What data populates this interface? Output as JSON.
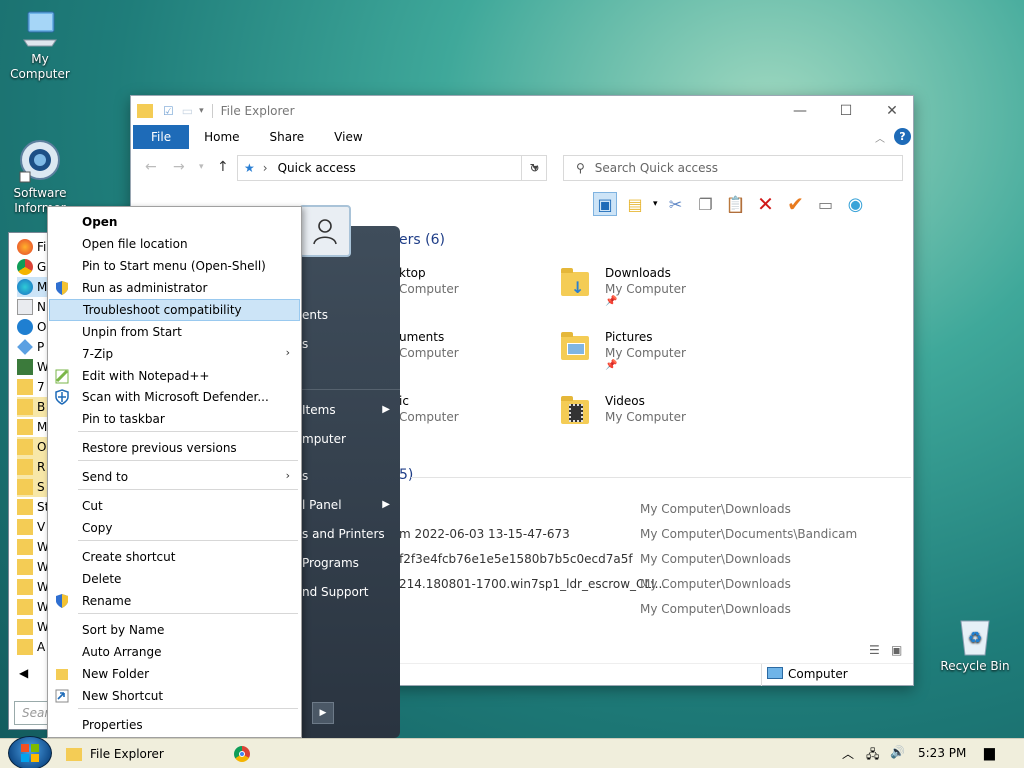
{
  "desktop": {
    "icons": [
      {
        "label": "My Computer",
        "icon": "computer-icon"
      },
      {
        "label": "Software\nInformer",
        "icon": "software-informer-icon"
      },
      {
        "label": "Recycle Bin",
        "icon": "recycle-bin-icon"
      }
    ]
  },
  "explorer": {
    "title": "File Explorer",
    "ribbon_tabs": [
      "File",
      "Home",
      "Share",
      "View"
    ],
    "address": "Quick access",
    "search_placeholder": "Search Quick access",
    "frequent_header": "ers (6)",
    "recent_header": "5)",
    "quick_items": [
      {
        "name": "ktop",
        "sub": "Computer"
      },
      {
        "name": "uments",
        "sub": "Computer"
      },
      {
        "name": "ic",
        "sub": "Computer"
      },
      {
        "name": "Downloads",
        "sub": "My Computer"
      },
      {
        "name": "Pictures",
        "sub": "My Computer"
      },
      {
        "name": "Videos",
        "sub": "My Computer"
      }
    ],
    "recent_files": [
      {
        "name": "",
        "path": "My Computer\\Downloads"
      },
      {
        "name": "m 2022-06-03 13-15-47-673",
        "path": "My Computer\\Documents\\Bandicam"
      },
      {
        "name": "f2f3e4fcb76e1e5e1580b7b5c0ecd7a5f",
        "path": "My Computer\\Downloads"
      },
      {
        "name": "214.180801-1700.win7sp1_ldr_escrow_CLI...",
        "path": "My Computer\\Downloads"
      },
      {
        "name": "",
        "path": "My Computer\\Downloads"
      }
    ],
    "status_location": "Computer"
  },
  "start_menu": {
    "left_items": [
      "Fi",
      "G",
      "M",
      "N",
      "O",
      "P",
      "W",
      "7",
      "B",
      "M",
      "O",
      "R",
      "S",
      "St",
      "V",
      "W",
      "W",
      "W",
      "W",
      "W",
      "A"
    ],
    "search_placeholder": "Sear",
    "right_items": [
      {
        "label": "ents",
        "arrow": false
      },
      {
        "label": "s",
        "arrow": false
      },
      {
        "label": "Items",
        "arrow": true
      },
      {
        "label": "mputer",
        "arrow": false
      },
      {
        "label": "s",
        "arrow": false
      },
      {
        "label": "l Panel",
        "arrow": true
      },
      {
        "label": "s and Printers",
        "arrow": false
      },
      {
        "label": "Programs",
        "arrow": false
      },
      {
        "label": "nd Support",
        "arrow": false
      }
    ]
  },
  "context_menu": {
    "items": [
      {
        "label": "Open",
        "bold": true
      },
      {
        "label": "Open file location"
      },
      {
        "label": "Pin to Start menu (Open-Shell)"
      },
      {
        "label": "Run as administrator",
        "icon": "shield-icon"
      },
      {
        "label": "Troubleshoot compatibility",
        "highlighted": true
      },
      {
        "label": "Unpin from Start"
      },
      {
        "label": "7-Zip",
        "submenu": true
      },
      {
        "label": "Edit with Notepad++",
        "icon": "notepad-plus-plus-icon"
      },
      {
        "label": "Scan with Microsoft Defender...",
        "icon": "defender-icon"
      },
      {
        "label": "Pin to taskbar"
      },
      {
        "label": "Restore previous versions"
      },
      {
        "label": "Send to",
        "submenu": true
      },
      {
        "label": "Cut"
      },
      {
        "label": "Copy"
      },
      {
        "label": "Create shortcut"
      },
      {
        "label": "Delete"
      },
      {
        "label": "Rename",
        "icon": "shield-icon"
      },
      {
        "label": "Sort by Name"
      },
      {
        "label": "Auto Arrange"
      },
      {
        "label": "New Folder",
        "icon": "folder-icon"
      },
      {
        "label": "New Shortcut",
        "icon": "shortcut-icon"
      },
      {
        "label": "Properties"
      }
    ]
  },
  "taskbar": {
    "app_label": "File Explorer",
    "clock": "5:23 PM"
  },
  "colors": {
    "accent": "#1e6bb8",
    "highlight": "#cce4f7",
    "section_header": "#1e3d87"
  }
}
